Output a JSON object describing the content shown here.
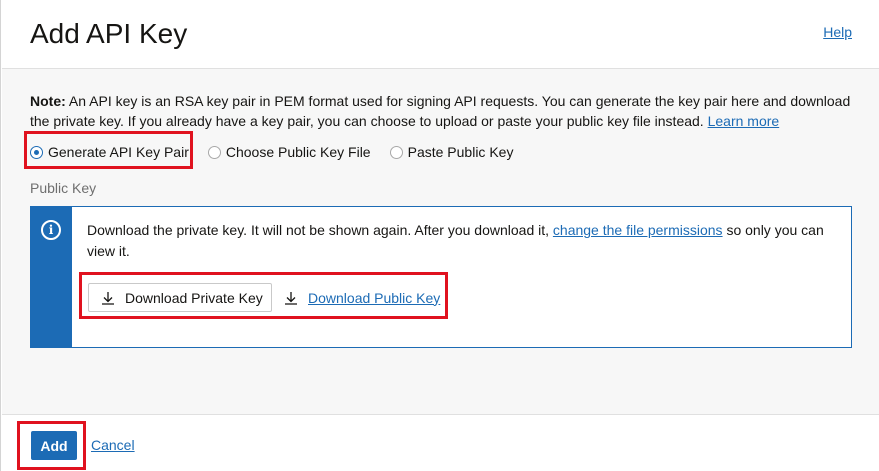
{
  "header": {
    "title": "Add API Key",
    "help_label": "Help"
  },
  "note": {
    "prefix": "Note:",
    "text": " An API key is an RSA key pair in PEM format used for signing API requests. You can generate the key pair here and download the private key. If you already have a key pair, you can choose to upload or paste your public key file instead. ",
    "link_label": "Learn more"
  },
  "key_options": {
    "selected": "Generate API Key Pair",
    "items": [
      {
        "label": "Generate API Key Pair",
        "checked": true
      },
      {
        "label": "Choose Public Key File",
        "checked": false
      },
      {
        "label": "Paste Public Key",
        "checked": false
      }
    ]
  },
  "public_key": {
    "label": "Public Key",
    "info": {
      "icon": "info-icon",
      "text_before": "Download the private key. It will not be shown again. After you download it, ",
      "link_label": "change the file permissions",
      "text_after": " so only you can view it."
    },
    "download_private_label": "Download Private Key",
    "download_public_label": "Download Public Key"
  },
  "footer": {
    "add_label": "Add",
    "cancel_label": "Cancel"
  },
  "colors": {
    "accent": "#1c6bb5",
    "highlight": "#e0121f",
    "background": "#f7f7f7"
  }
}
